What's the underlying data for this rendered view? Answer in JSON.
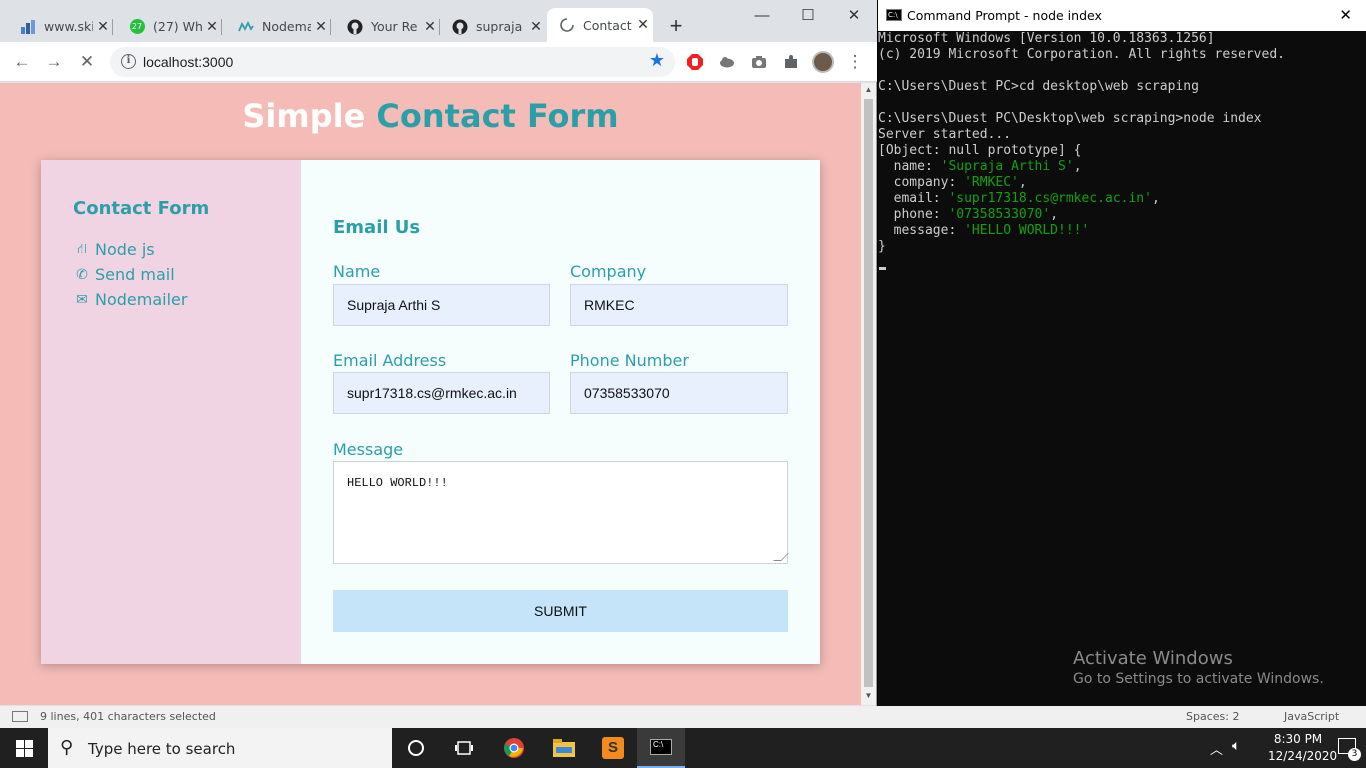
{
  "browser": {
    "tabs": [
      {
        "title": "www.ski",
        "icon": "chart-favicon"
      },
      {
        "title": "(27) Wh",
        "icon": "whatsapp-favicon",
        "badge": "27"
      },
      {
        "title": "Nodema",
        "icon": "nodemailer-favicon"
      },
      {
        "title": "Your Re",
        "icon": "github-favicon"
      },
      {
        "title": "supraja",
        "icon": "github-favicon"
      },
      {
        "title": "Contact",
        "icon": "loading-spinner"
      }
    ],
    "new_tab": "+",
    "url": "localhost:3000"
  },
  "page": {
    "title_white": "Simple",
    "title_teal": "Contact Form",
    "sidebar": {
      "heading": "Contact Form",
      "items": [
        {
          "label": "Node js",
          "icon": "road-icon"
        },
        {
          "label": "Send mail",
          "icon": "phone-icon"
        },
        {
          "label": "Nodemailer",
          "icon": "envelope-icon"
        }
      ]
    },
    "form": {
      "heading": "Email Us",
      "name_label": "Name",
      "name_value": "Supraja Arthi S",
      "company_label": "Company",
      "company_value": "RMKEC",
      "email_label": "Email Address",
      "email_value": "supr17318.cs@rmkec.ac.in",
      "phone_label": "Phone Number",
      "phone_value": "07358533070",
      "message_label": "Message",
      "message_value": "HELLO WORLD!!!",
      "submit_label": "SUBMIT"
    }
  },
  "cmd": {
    "title": "Command Prompt - node  index",
    "lines": [
      "Microsoft Windows [Version 10.0.18363.1256]",
      "(c) 2019 Microsoft Corporation. All rights reserved.",
      "",
      "C:\\Users\\Duest PC>cd desktop\\web scraping",
      "",
      "C:\\Users\\Duest PC\\Desktop\\web scraping>node index",
      "Server started...",
      "[Object: null prototype] {"
    ],
    "fields": [
      {
        "key": "  name: ",
        "val": "'Supraja Arthi S'",
        "end": ","
      },
      {
        "key": "  company: ",
        "val": "'RMKEC'",
        "end": ","
      },
      {
        "key": "  email: ",
        "val": "'supr17318.cs@rmkec.ac.in'",
        "end": ","
      },
      {
        "key": "  phone: ",
        "val": "'07358533070'",
        "end": ","
      },
      {
        "key": "  message: ",
        "val": "'HELLO WORLD!!!'",
        "end": ""
      }
    ],
    "closing": "}",
    "activate_title": "Activate Windows",
    "activate_sub": "Go to Settings to activate Windows."
  },
  "editor_status": {
    "selection": "9 lines, 401 characters selected",
    "spaces": "Spaces: 2",
    "language": "JavaScript"
  },
  "taskbar": {
    "search_placeholder": "Type here to search",
    "time": "8:30 PM",
    "date": "12/24/2020",
    "notifications": "3"
  },
  "colors": {
    "accent": "#2b9fa8",
    "page_bg": "#f5bbb7",
    "sidebar_bg": "#f0d4e4"
  }
}
